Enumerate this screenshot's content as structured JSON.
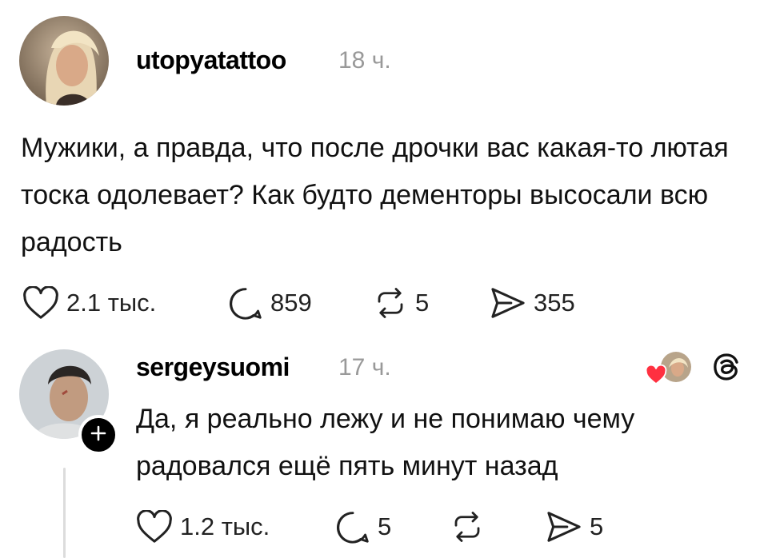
{
  "post": {
    "author": "utopyatattoo",
    "time": "18 ч.",
    "text": "Мужики, а правда, что после дрочки вас какая-то лютая тоска одолевает? Как будто дементоры высосали всю радость",
    "likes": "2.1 тыс.",
    "comments": "859",
    "reposts": "5",
    "shares": "355"
  },
  "reply": {
    "author": "sergeysuomi",
    "time": "17 ч.",
    "text": "Да, я реально лежу и не понимаю чему радовался ещё пять минут назад",
    "likes": "1.2 тыс.",
    "comments": "5",
    "reposts": "",
    "shares": "5"
  },
  "icons": {
    "like": "heart-outline-icon",
    "comment": "speech-bubble-icon",
    "repost": "repost-arrows-icon",
    "share": "send-icon",
    "follow": "plus-icon",
    "liked_by_author": "red-heart-icon",
    "threads": "threads-logo-icon"
  },
  "colors": {
    "liked_heart": "#ff3040",
    "secondary_text": "#999999"
  }
}
